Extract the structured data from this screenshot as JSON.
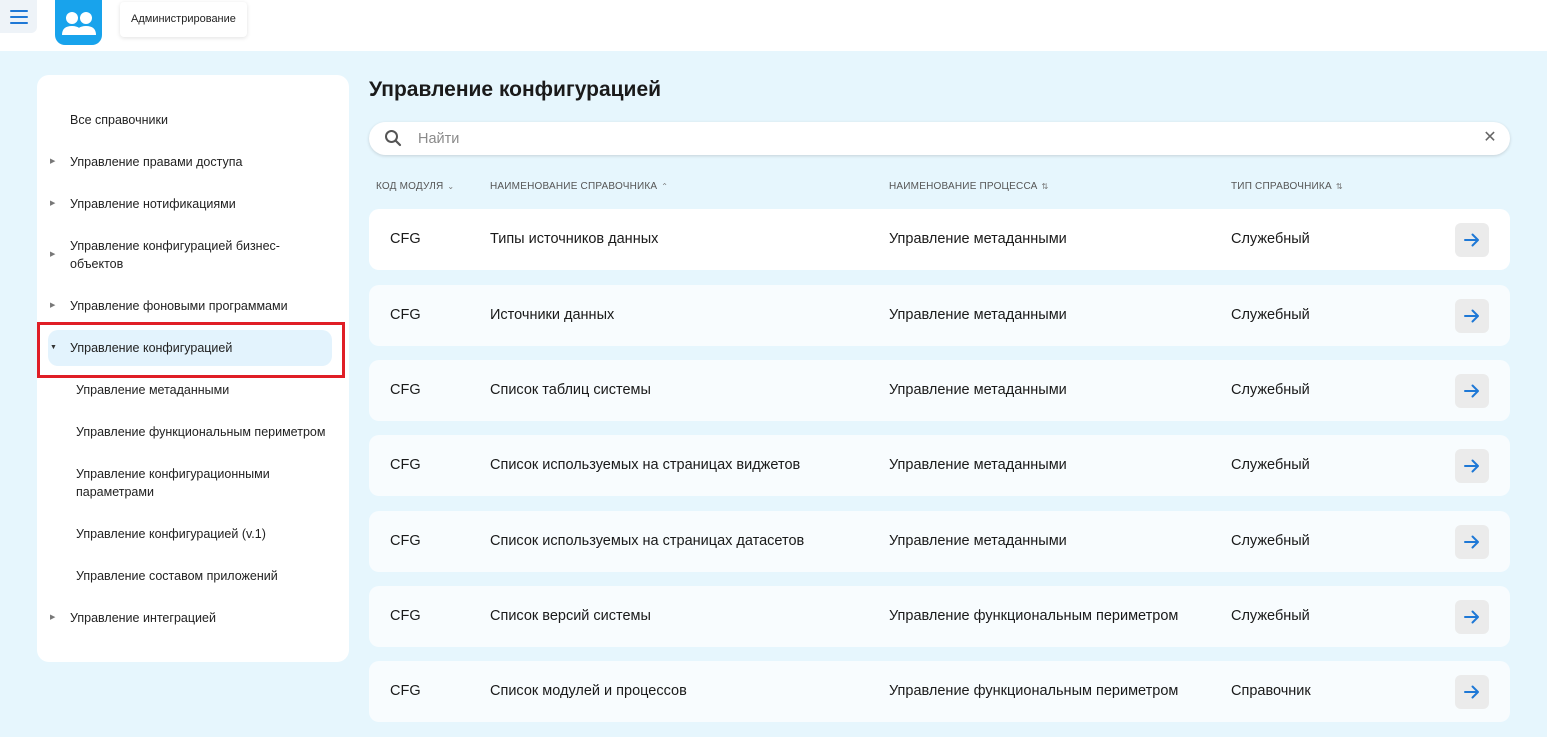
{
  "header": {
    "app_tab": "Администрирование"
  },
  "sidebar": {
    "items": [
      {
        "label": "Все справочники",
        "expandable": false
      },
      {
        "label": "Управление правами доступа",
        "expandable": true
      },
      {
        "label": "Управление нотификациями",
        "expandable": true
      },
      {
        "label": "Управление конфигурацией бизнес-объектов",
        "expandable": true
      },
      {
        "label": "Управление фоновыми программами",
        "expandable": true
      },
      {
        "label": "Управление конфигурацией",
        "expandable": true,
        "expanded": true,
        "active": true
      },
      {
        "label": "Управление интеграцией",
        "expandable": true
      }
    ],
    "subitems": [
      {
        "label": "Управление метаданными"
      },
      {
        "label": "Управление функциональным периметром"
      },
      {
        "label": "Управление конфигурационными параметрами"
      },
      {
        "label": "Управление конфигурацией (v.1)"
      },
      {
        "label": "Управление составом приложений"
      }
    ]
  },
  "main": {
    "title": "Управление конфигурацией",
    "search": {
      "placeholder": "Найти",
      "value": ""
    },
    "columns": [
      {
        "label": "КОД МОДУЛЯ",
        "sort": "desc"
      },
      {
        "label": "НАИМЕНОВАНИЕ СПРАВОЧНИКА",
        "sort": "asc"
      },
      {
        "label": "НАИМЕНОВАНИЕ ПРОЦЕССА",
        "sort": "none"
      },
      {
        "label": "ТИП СПРАВОЧНИКА",
        "sort": "none"
      }
    ],
    "rows": [
      {
        "code": "CFG",
        "name": "Типы источников данных",
        "process": "Управление метаданными",
        "type": "Служебный"
      },
      {
        "code": "CFG",
        "name": "Источники данных",
        "process": "Управление метаданными",
        "type": "Служебный"
      },
      {
        "code": "CFG",
        "name": "Список таблиц системы",
        "process": "Управление метаданными",
        "type": "Служебный"
      },
      {
        "code": "CFG",
        "name": "Список используемых на страницах виджетов",
        "process": "Управление метаданными",
        "type": "Служебный"
      },
      {
        "code": "CFG",
        "name": "Список используемых на страницах датасетов",
        "process": "Управление метаданными",
        "type": "Служебный"
      },
      {
        "code": "CFG",
        "name": "Список версий системы",
        "process": "Управление функциональным периметром",
        "type": "Служебный"
      },
      {
        "code": "CFG",
        "name": "Список модулей и процессов",
        "process": "Управление функциональным периметром",
        "type": "Справочник"
      }
    ]
  },
  "colors": {
    "accent": "#1e78d6",
    "logo": "#18a3ec",
    "background": "#e6f6fd",
    "highlight": "#e01e26"
  },
  "icons": {
    "menu": "hamburger-icon",
    "logo": "users-icon",
    "search": "search-icon",
    "clear": "close-icon",
    "row_action": "arrow-right-icon",
    "sort_desc": "chevron-down-icon",
    "sort_asc": "chevron-up-icon",
    "sort_none": "sort-icon"
  }
}
